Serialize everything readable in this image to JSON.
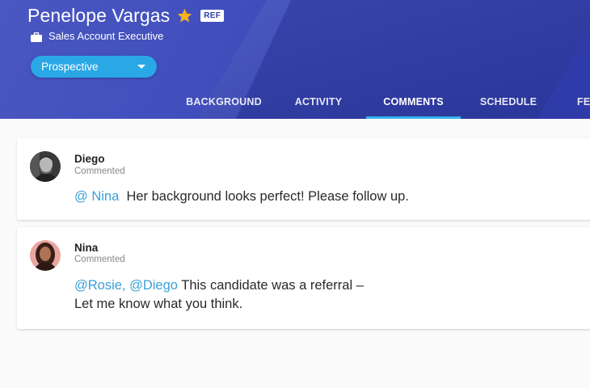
{
  "profile": {
    "name": "Penelope Vargas",
    "badge": "REF",
    "job_title": "Sales Account Executive",
    "status": "Prospective",
    "star_color": "#f6b21b"
  },
  "tabs": [
    {
      "label": "BACKGROUND",
      "active": false
    },
    {
      "label": "ACTIVITY",
      "active": false
    },
    {
      "label": "COMMENTS",
      "active": true
    },
    {
      "label": "SCHEDULE",
      "active": false
    },
    {
      "label": "FE",
      "active": false
    }
  ],
  "comments": [
    {
      "author": "Diego",
      "action": "Commented",
      "mention": "@ Nina",
      "text": "Her background looks perfect! Please follow up."
    },
    {
      "author": "Nina",
      "action": "Commented",
      "mention": "@Rosie, @Diego",
      "text_line1": "This candidate was a referral –",
      "text_line2": "Let me know what you think."
    }
  ],
  "colors": {
    "header": "#3442b0",
    "accent": "#2aa8e6",
    "mention": "#3a9fd8",
    "tab_indicator": "#37b3ee"
  }
}
